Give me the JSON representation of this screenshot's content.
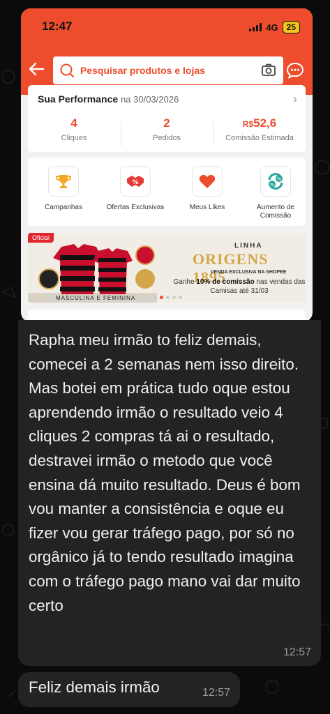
{
  "screenshot": {
    "status_bar": {
      "time": "12:47",
      "network": "4G",
      "battery": "25"
    },
    "search": {
      "placeholder": "Pesquisar produtos e lojas"
    },
    "performance": {
      "title": "Sua Performance",
      "date": "na 30/03/2026",
      "stats": [
        {
          "value": "4",
          "label": "Cliques"
        },
        {
          "value": "2",
          "label": "Pedidos"
        },
        {
          "currency": "R$",
          "value": "52,6",
          "label": "Comissão Estimada"
        }
      ]
    },
    "shortcuts": [
      {
        "label": "Campanhas",
        "icon": "trophy-icon"
      },
      {
        "label": "Ofertas Exclusivas",
        "icon": "handshake-icon"
      },
      {
        "label": "Meus Likes",
        "icon": "heart-icon"
      },
      {
        "label": "Aumento de Comissão",
        "icon": "percent-cycle-icon"
      }
    ],
    "banner": {
      "badge": "Oficial",
      "caption": "MASCULINA E FEMININA",
      "line": "LINHA",
      "collection": "ORIGENS 1895",
      "exclusive": "VENDA EXCLUSIVA NA SHOPEE",
      "gain_pre": "Ganhe ",
      "gain_bold": "10% de comissão",
      "gain_post": " nas vendas das Camisas até 31/03"
    }
  },
  "messages": [
    {
      "text": "Rapha meu irmão to feliz demais, comecei a 2 semanas nem isso direito. Mas botei em prática tudo oque estou aprendendo irmão o resultado veio 4 cliques 2 compras tá ai o resultado, destravei irmão o metodo que você ensina dá muito resultado. Deus é bom vou manter a consistência e oque eu fizer vou gerar tráfego pago, por só no orgânico já to tendo resultado imagina com o tráfego pago mano vai dar muito certo",
      "time": "12:57"
    },
    {
      "text": "Feliz demais irmão",
      "time": "12:57"
    }
  ],
  "colors": {
    "brand": "#ee4d2d",
    "bubble": "#232323",
    "background": "#0b0b0b"
  }
}
